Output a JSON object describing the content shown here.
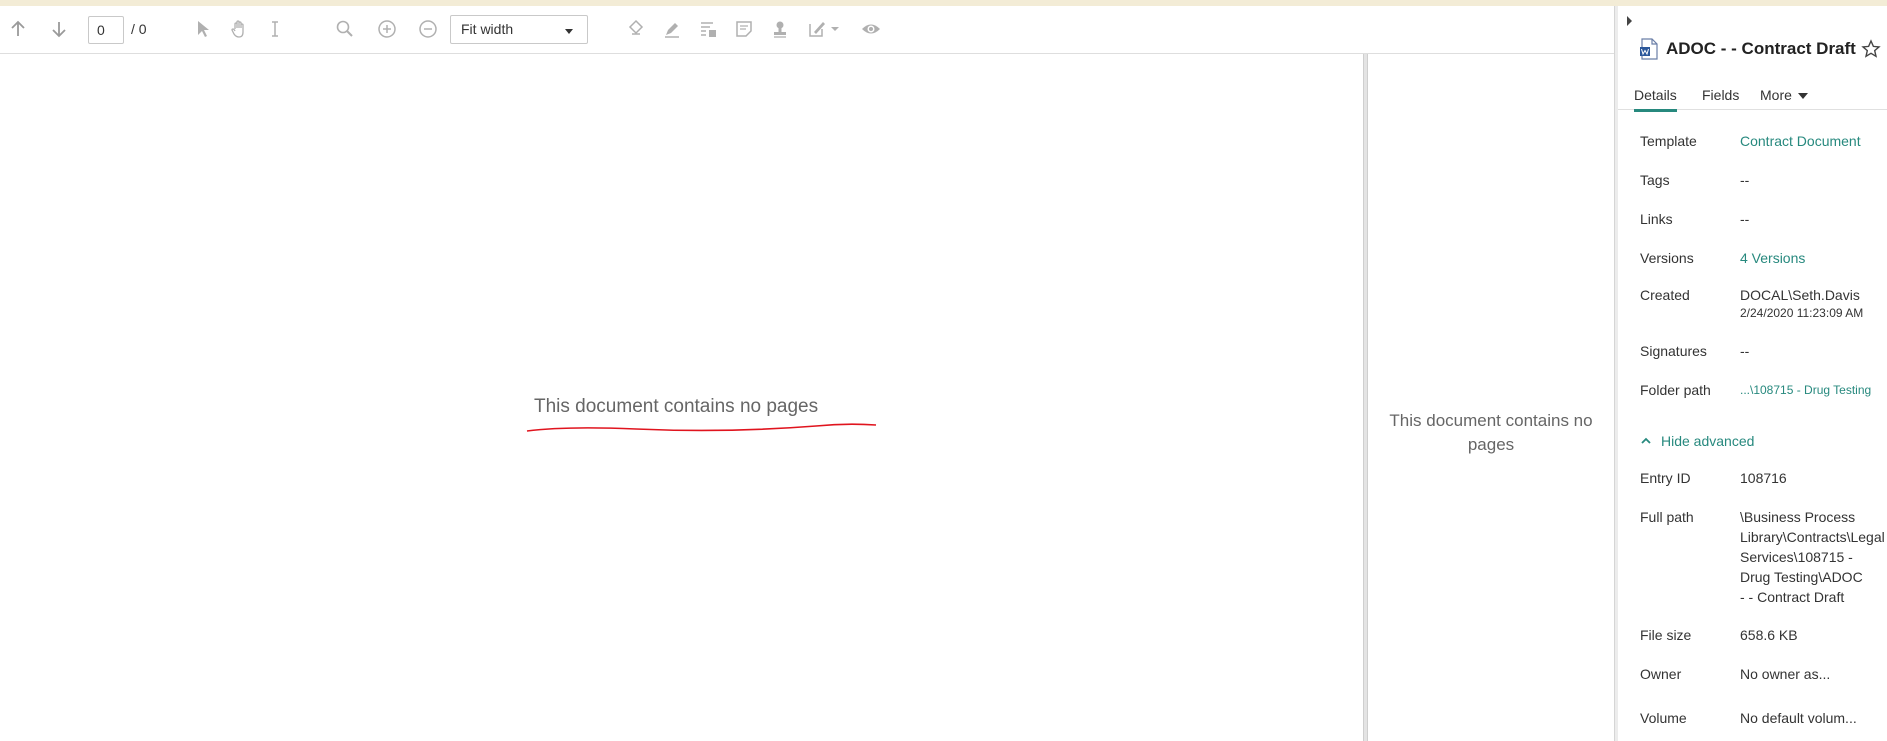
{
  "toolbar": {
    "page_current": "0",
    "page_total": "/ 0",
    "zoom_value": "Fit width",
    "icons": [
      "arrow-up-icon",
      "arrow-down-icon",
      "select-pointer-icon",
      "pan-hand-icon",
      "text-cursor-icon",
      "zoom-magnifier-icon",
      "zoom-in-icon",
      "zoom-out-icon",
      "redact-icon",
      "highlight-icon",
      "text-box-icon",
      "sticky-note-icon",
      "stamp-icon",
      "annotate-dropdown-icon",
      "show-annotations-icon"
    ]
  },
  "viewer": {
    "main_message": "This document contains no pages",
    "thumbnail_message": "This document contains no pages"
  },
  "panel": {
    "title": "ADOC - - Contract Draft",
    "tabs": {
      "details": "Details",
      "fields": "Fields",
      "more": "More"
    },
    "properties": {
      "template_label": "Template",
      "template_value": "Contract Document",
      "tags_label": "Tags",
      "tags_value": "--",
      "links_label": "Links",
      "links_value": "--",
      "versions_label": "Versions",
      "versions_value": "4 Versions",
      "created_label": "Created",
      "created_user": "DOCAL\\Seth.Davis",
      "created_date": "2/24/2020 11:23:09 AM",
      "signatures_label": "Signatures",
      "signatures_value": "--",
      "folder_label": "Folder path",
      "folder_value": "...\\108715 - Drug Testing"
    },
    "advanced": {
      "toggle_label": "Hide advanced",
      "entry_id_label": "Entry ID",
      "entry_id_value": "108716",
      "full_path_label": "Full path",
      "full_path_value": "\\Business Process\nLibrary\\Contracts\\Legal\nServices\\108715 -\nDrug Testing\\ADOC\n- - Contract Draft",
      "file_size_label": "File size",
      "file_size_value": "658.6 KB",
      "owner_label": "Owner",
      "owner_value": "No owner as...",
      "volume_label": "Volume",
      "volume_value": "No default volum..."
    }
  },
  "colors": {
    "accent": "#27897e",
    "underline": "#e0141e",
    "icon_gray": "#9a9a9a"
  }
}
